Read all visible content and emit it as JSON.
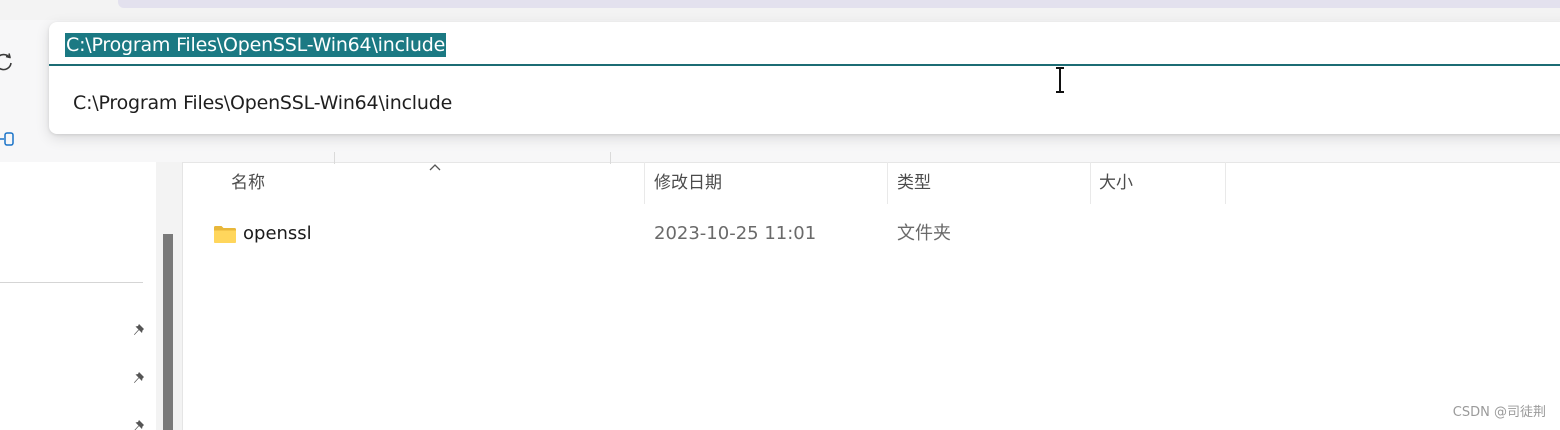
{
  "address_bar": {
    "value": "C:\\Program Files\\OpenSSL-Win64\\include",
    "suggestions": [
      "C:\\Program Files\\OpenSSL-Win64\\include"
    ]
  },
  "file_list": {
    "columns": [
      "名称",
      "修改日期",
      "类型",
      "大小"
    ],
    "rows": [
      {
        "name": "openssl",
        "modified": "2023-10-25 11:01",
        "type": "文件夹",
        "size": ""
      }
    ]
  },
  "icons": {
    "refresh": "refresh-icon",
    "sidebar": "sidebar-toggle-icon",
    "pin": "pin-icon",
    "folder": "folder-icon",
    "sort": "sort-ascending-icon",
    "cursor": "text-cursor-icon"
  },
  "colors": {
    "selection": "#1b7983",
    "input_underline": "#1c6c74",
    "folder": "#f4c542",
    "scroll_thumb": "#7a7a7a"
  },
  "watermark": "CSDN @司徒荆"
}
